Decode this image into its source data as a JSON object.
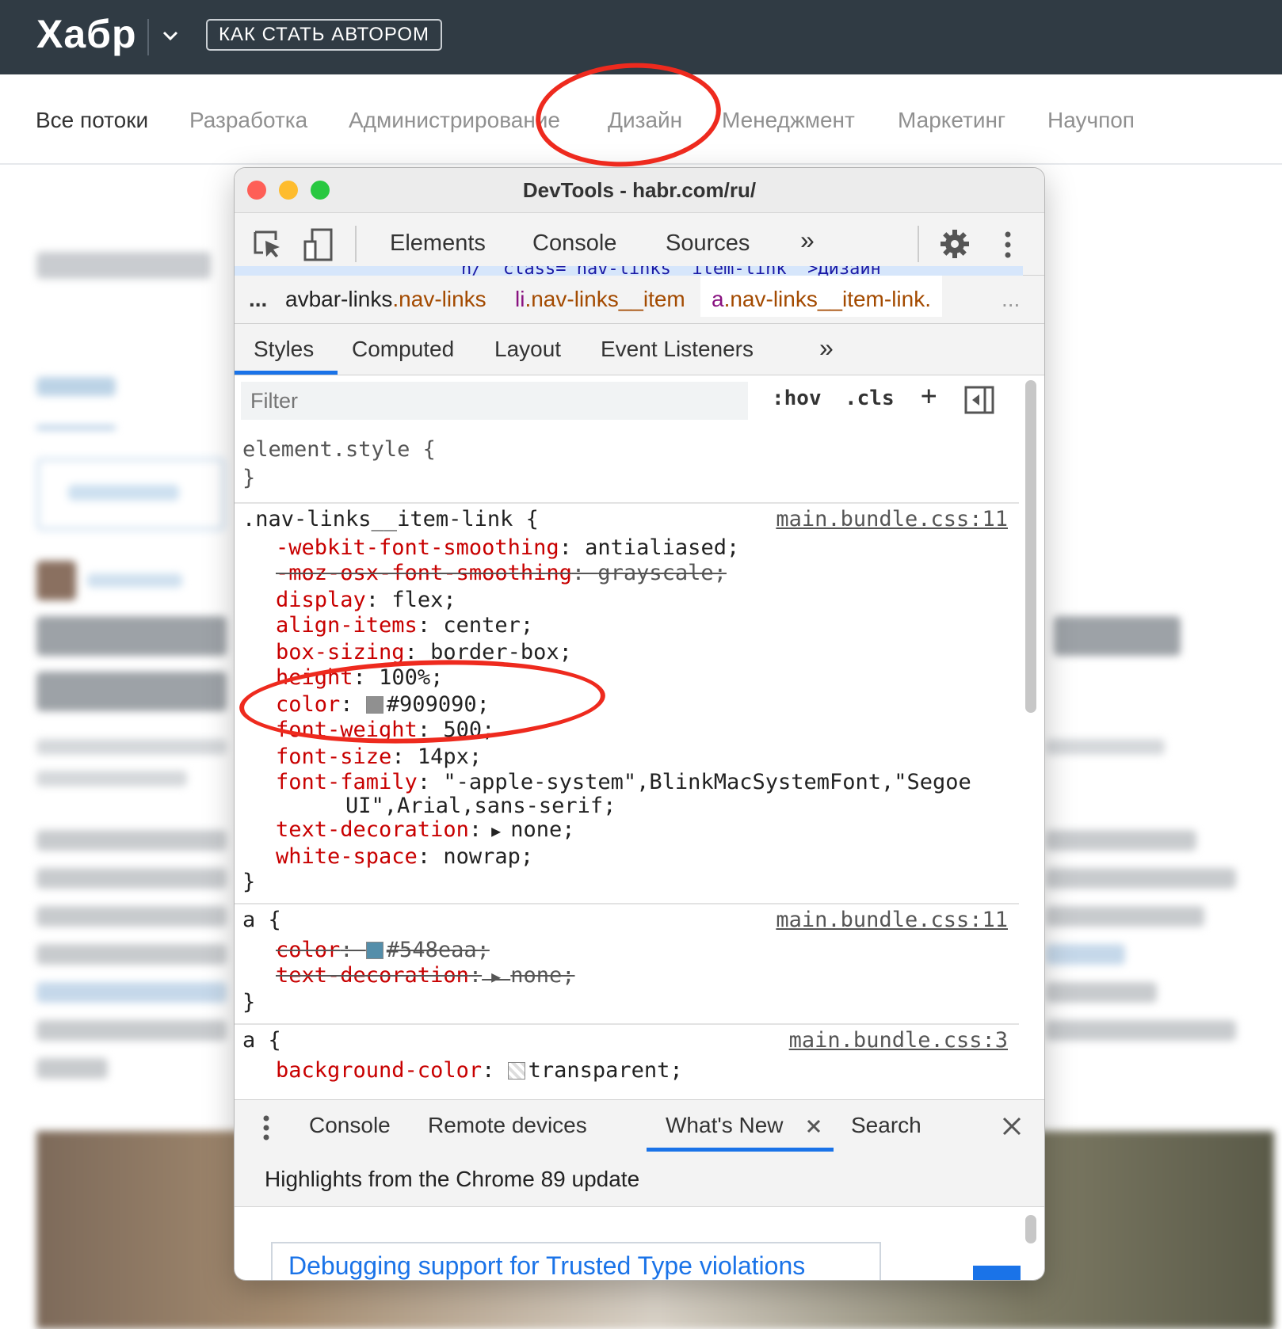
{
  "habr": {
    "logo": "Хабр",
    "author_button": "КАК СТАТЬ АВТОРОМ",
    "flows": [
      "Все потоки",
      "Разработка",
      "Администрирование",
      "Дизайн",
      "Менеджмент",
      "Маркетинг",
      "Научпоп"
    ]
  },
  "devtools": {
    "title": "DevTools - habr.com/ru/",
    "main_tabs": {
      "elements": "Elements",
      "console": "Console",
      "sources": "Sources",
      "more": "»"
    },
    "dom_snippet": "n/\" class=\"nav-links__item-link \">Дизайн",
    "breadcrumbs": {
      "ellipsis": "...",
      "b1_tag": "avbar-links",
      "b1_class": ".nav-links",
      "b2_tag": "li",
      "b2_class": ".nav-links__item",
      "b3_tag": "a",
      "b3_class": ".nav-links__item-link.",
      "more": "..."
    },
    "sub_tabs": {
      "styles": "Styles",
      "computed": "Computed",
      "layout": "Layout",
      "listeners": "Event Listeners",
      "more": "»"
    },
    "filter": {
      "placeholder": "Filter",
      "hov": ":hov",
      "cls": ".cls",
      "plus": "+"
    },
    "rules": {
      "element_style": "element.style {",
      "close": "}",
      "r1_selector": ".nav-links__item-link {",
      "r1_source": "main.bundle.css:11",
      "r1_decls": [
        {
          "p": "-webkit-font-smoothing",
          "v": "antialiased;"
        },
        {
          "p": "-moz-osx-font-smoothing",
          "v": "grayscale;"
        },
        {
          "p": "display",
          "v": "flex;"
        },
        {
          "p": "align-items",
          "v": "center;"
        },
        {
          "p": "box-sizing",
          "v": "border-box;"
        },
        {
          "p": "height",
          "v": "100%;"
        },
        {
          "p": "color",
          "v": "#909090;"
        },
        {
          "p": "font-weight",
          "v": "500;"
        },
        {
          "p": "font-size",
          "v": "14px;"
        },
        {
          "p": "font-family",
          "v": "\"-apple-system\",BlinkMacSystemFont,\"Segoe"
        },
        {
          "p": "",
          "v": "UI\",Arial,sans-serif;"
        },
        {
          "p": "text-decoration",
          "v": "none;"
        },
        {
          "p": "white-space",
          "v": "nowrap;"
        }
      ],
      "r2_selector": "a {",
      "r2_source": "main.bundle.css:11",
      "r2_decls": [
        {
          "p": "color",
          "v": "#548eaa;"
        },
        {
          "p": "text-decoration",
          "v": "none;"
        }
      ],
      "r3_selector": "a {",
      "r3_source": "main.bundle.css:3",
      "r3_decls": [
        {
          "p": "background-color",
          "v": "transparent;"
        }
      ]
    },
    "drawer_tabs": {
      "console": "Console",
      "remote": "Remote devices",
      "whatsnew": "What's New",
      "search": "Search"
    },
    "whatsnew_header": "Highlights from the Chrome 89 update",
    "whatsnew_card": "Debugging support for Trusted Type violations"
  },
  "colors": {
    "swatch_1": "#909090",
    "swatch_2": "#548eaa",
    "annotation": "#ee2a1e",
    "accent": "#1a73e8"
  }
}
